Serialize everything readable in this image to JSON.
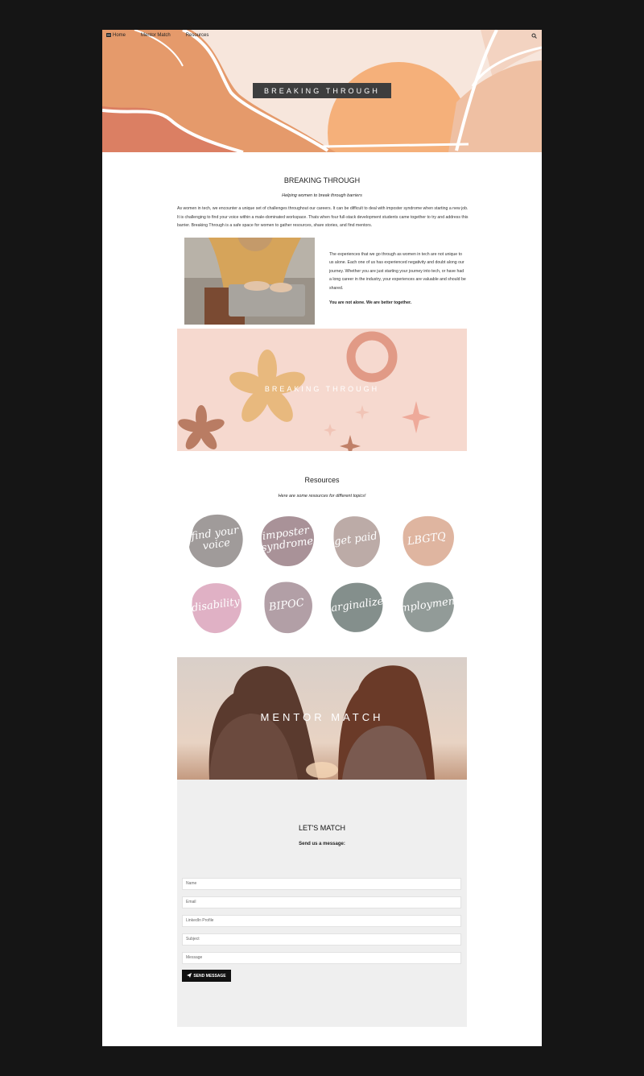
{
  "nav": {
    "items": [
      {
        "label": "Home",
        "icon": "grid-icon"
      },
      {
        "label": "Mentor Match",
        "icon": "table-icon"
      },
      {
        "label": "Resources",
        "icon": "grid-icon"
      }
    ],
    "search_icon": "search-icon"
  },
  "hero": {
    "title": "BREAKING THROUGH"
  },
  "intro": {
    "heading": "BREAKING THROUGH",
    "tagline": "Helping women to break through barriers",
    "paragraph": "As women in tech, we encounter a unique set of challenges throughout our careers. It can be difficult to deal with imposter syndrome when starting a new job. It is challenging to find your voice within a male-dominated workspace. Thats when four full-stack development students came together to try and address this barrier. Breaking Through is a safe space for women to gather resources, share stories, and find mentors.",
    "side_text": "The experiences that we go through as women in tech are not unique to us alone. Each one of us has experienced negativity and doubt along our journey. Whether you are just starting your journey into tech, or have had a long career in the industry, your experiences are valuable and should be shared.",
    "side_bold": "You are not alone. We are better together."
  },
  "banner": {
    "text": "BREAKING THROUGH"
  },
  "resources": {
    "heading": "Resources",
    "tagline": "Here are some resources for different topics!",
    "topics": [
      {
        "label": "find your voice",
        "color": "#8f8a88"
      },
      {
        "label": "imposter syndrome",
        "color": "#9a7f86"
      },
      {
        "label": "get paid",
        "color": "#b09c98"
      },
      {
        "label": "LBGTQ",
        "color": "#d9a88f"
      },
      {
        "label": "disability",
        "color": "#dba3bb"
      },
      {
        "label": "BIPOC",
        "color": "#a58e97"
      },
      {
        "label": "marginalized",
        "color": "#6f7b78"
      },
      {
        "label": "employment",
        "color": "#7f8a86"
      }
    ]
  },
  "mentor": {
    "text": "MENTOR MATCH"
  },
  "contact": {
    "title": "LET'S MATCH",
    "subtitle": "Send us a message:",
    "fields": [
      {
        "placeholder": "Name"
      },
      {
        "placeholder": "Email"
      },
      {
        "placeholder": "LinkedIn Profile"
      },
      {
        "placeholder": "Subject"
      },
      {
        "placeholder": "Message"
      }
    ],
    "send_label": "SEND MESSAGE"
  },
  "colors": {
    "accent": "#f4b27c",
    "dark": "#3e3e3e",
    "background": "#151515"
  }
}
